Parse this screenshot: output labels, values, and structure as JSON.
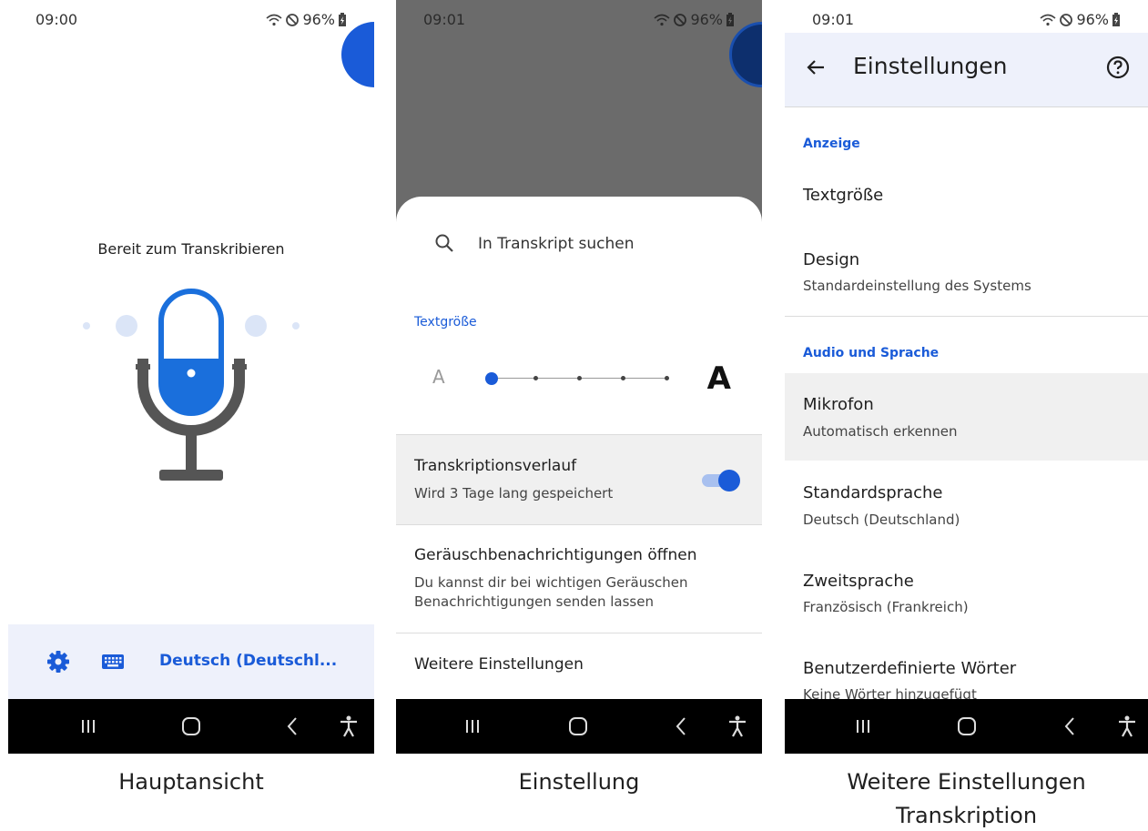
{
  "status": {
    "p1_time": "09:00",
    "p2_time": "09:01",
    "p3_time": "09:01",
    "battery": "96%"
  },
  "main_view": {
    "title": "Bereit zum Transkribieren",
    "language": "Deutsch (Deutschl...",
    "accent": "#1a5bd8"
  },
  "settings_sheet": {
    "search_placeholder": "In Transkript suchen",
    "text_size_label": "Textgröße",
    "text_size_small": "A",
    "text_size_large": "A",
    "text_size_level": 0,
    "history": {
      "title": "Transkriptionsverlauf",
      "subtitle": "Wird 3 Tage lang gespeichert",
      "enabled": true
    },
    "sound_notifications": {
      "title": "Geräuschbenachrichtigungen öffnen",
      "subtitle_line1": "Du kannst dir bei wichtigen Geräuschen",
      "subtitle_line2": "Benachrichtigungen senden lassen"
    },
    "more_settings": "Weitere Einstellungen"
  },
  "more_settings_screen": {
    "title": "Einstellungen",
    "display_section": "Anzeige",
    "text_size": "Textgröße",
    "design_title": "Design",
    "design_value": "Standardeinstellung des Systems",
    "audio_section": "Audio und Sprache",
    "microphone_title": "Mikrofon",
    "microphone_value": "Automatisch erkennen",
    "default_lang_title": "Standardsprache",
    "default_lang_value": "Deutsch (Deutschland)",
    "second_lang_title": "Zweitsprache",
    "second_lang_value": "Französisch (Frankreich)",
    "custom_words_title": "Benutzerdefinierte Wörter",
    "custom_words_value": "Keine Wörter hinzugefügt"
  },
  "captions": {
    "main": "Hauptansicht",
    "settings": "Einstellung",
    "more_line1": "Weitere Einstellungen",
    "more_line2": "Transkription"
  }
}
